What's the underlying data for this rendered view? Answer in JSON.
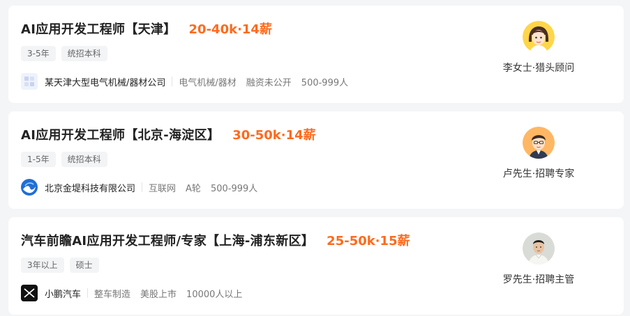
{
  "jobs": [
    {
      "title": "AI应用开发工程师【天津】",
      "salary": "20-40k·14薪",
      "tags": [
        "3-5年",
        "统招本科"
      ],
      "company": "某天津大型电气机械/器材公司",
      "industry": "电气机械/器材",
      "funding": "融资未公开",
      "size": "500-999人",
      "logo_icon": "placeholder-building-icon",
      "recruiter": "李女士·猎头顾问",
      "avatar_icon": "female-avatar-icon"
    },
    {
      "title": "AI应用开发工程师【北京-海淀区】",
      "salary": "30-50k·14薪",
      "tags": [
        "1-5年",
        "统招本科"
      ],
      "company": "北京金堤科技有限公司",
      "industry": "互联网",
      "funding": "A轮",
      "size": "500-999人",
      "logo_icon": "blue-wave-logo-icon",
      "recruiter": "卢先生·招聘专家",
      "avatar_icon": "male-avatar-icon"
    },
    {
      "title": "汽车前瞻AI应用开发工程师/专家【上海-浦东新区】",
      "salary": "25-50k·15薪",
      "tags": [
        "3年以上",
        "硕士"
      ],
      "company": "小鹏汽车",
      "industry": "整车制造",
      "funding": "美股上市",
      "size": "10000人以上",
      "logo_icon": "xpeng-logo-icon",
      "recruiter": "罗先生·招聘主管",
      "avatar_icon": "photo-avatar-icon"
    }
  ],
  "colors": {
    "salary": "#fe6a1d",
    "page_bg": "#f4f5f7",
    "card_bg": "#ffffff",
    "tag_bg": "#f3f4f6"
  }
}
